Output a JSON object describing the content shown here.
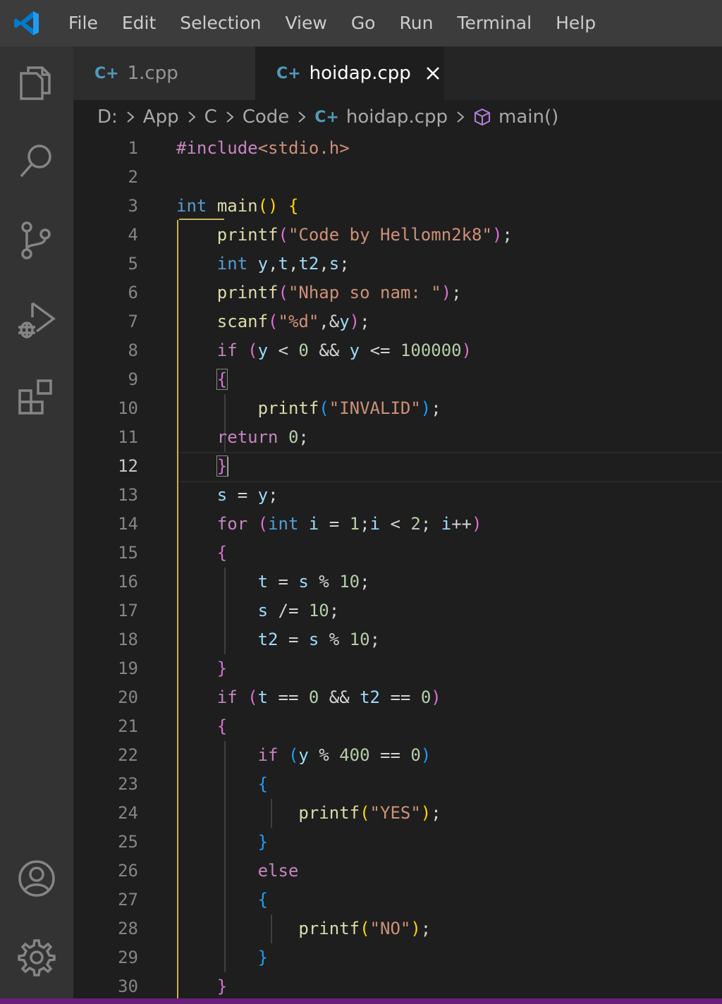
{
  "menu": [
    "File",
    "Edit",
    "Selection",
    "View",
    "Go",
    "Run",
    "Terminal",
    "Help"
  ],
  "tabs": [
    {
      "label": "1.cpp",
      "icon": "cpp-file-icon"
    },
    {
      "label": "hoidap.cpp",
      "icon": "cpp-file-icon",
      "active": true
    }
  ],
  "breadcrumb": [
    "D:",
    "App",
    "C",
    "Code",
    "hoidap.cpp",
    "main()"
  ],
  "editor": {
    "current_line": 12,
    "line_numbers": [
      "1",
      "2",
      "3",
      "4",
      "5",
      "6",
      "7",
      "8",
      "9",
      "10",
      "11",
      "12",
      "13",
      "14",
      "15",
      "16",
      "17",
      "18",
      "19",
      "20",
      "21",
      "22",
      "23",
      "24",
      "25",
      "26",
      "27",
      "28",
      "29",
      "30"
    ],
    "lines": [
      "#include<stdio.h>",
      "",
      "int main() {",
      "    printf(\"Code by Hellomn2k8\");",
      "    int y,t,t2,s;",
      "    printf(\"Nhap so nam: \");",
      "    scanf(\"%d\",&y);",
      "    if (y < 0 && y <= 100000)",
      "    {",
      "        printf(\"INVALID\");",
      "    return 0;",
      "    }",
      "    s = y;",
      "    for (int i = 1;i < 2; i++)",
      "    {",
      "        t = s % 10;",
      "        s /= 10;",
      "        t2 = s % 10;",
      "    }",
      "    if (t == 0 && t2 == 0)",
      "    {",
      "        if (y % 400 == 0)",
      "        {",
      "            printf(\"YES\");",
      "        }",
      "        else",
      "        {",
      "            printf(\"NO\");",
      "        }",
      "    }"
    ]
  },
  "colors": {
    "accent_bottom_bar": "#68217a",
    "keyword": "#569cd6",
    "control": "#c586c0",
    "function": "#dcdcaa",
    "string": "#ce9178",
    "number": "#b5cea8",
    "variable": "#9cdcfe"
  }
}
